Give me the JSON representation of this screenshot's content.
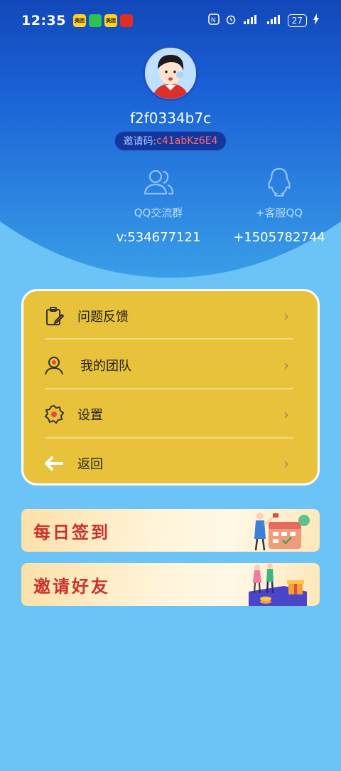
{
  "status_bar": {
    "time": "12:35",
    "battery": "27",
    "app_icons": [
      "美团",
      "微信",
      "美团",
      "拼多多"
    ]
  },
  "profile": {
    "username": "f2f0334b7c",
    "invite_label": "邀请码:",
    "invite_code": "c41abKz6E4"
  },
  "stats": [
    {
      "label": "QQ交流群",
      "value": "v:534677121",
      "icon": "group-icon"
    },
    {
      "label": "+客服QQ",
      "value": "+1505782744",
      "icon": "qq-penguin-icon"
    }
  ],
  "menu": {
    "items": [
      {
        "label": "问题反馈",
        "icon": "feedback-clipboard-icon"
      },
      {
        "label": "我的团队",
        "icon": "team-icon"
      },
      {
        "label": "设置",
        "icon": "gear-icon"
      },
      {
        "label": "返回",
        "icon": "back-arrow-icon"
      }
    ],
    "chevron": "›"
  },
  "banners": [
    {
      "label": "每日签到",
      "icon": "calendar-checkin-illustration"
    },
    {
      "label": "邀请好友",
      "icon": "gift-invite-illustration"
    }
  ],
  "colors": {
    "header_blue": "#0b2e9e",
    "page_bg": "#6cc3f5",
    "menu_card": "#e8c23a",
    "banner_text": "#c9322c",
    "invite_code": "#ff6a6a"
  }
}
